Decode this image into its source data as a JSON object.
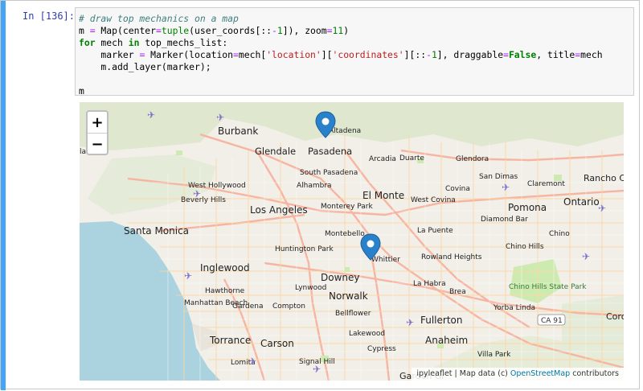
{
  "cell": {
    "prompt": "In [136]:",
    "code": {
      "line1_comment": "# draw top mechanics on a map",
      "line2": [
        "m ",
        "=",
        " Map(center",
        "=",
        "tuple",
        "(user_coords[::",
        "-",
        "1",
        "]), zoom",
        "=",
        "11",
        ")"
      ],
      "line3": [
        "for",
        " mech ",
        "in",
        " top_mechs_list:"
      ],
      "line4": [
        "    marker ",
        "=",
        " Marker(location",
        "=",
        "mech[",
        "'location'",
        "][",
        "'coordinates'",
        "][::",
        "-",
        "1",
        "], draggable",
        "=",
        "False",
        ", title",
        "=",
        "mech"
      ],
      "line5": "    m.add_layer(marker);",
      "line6": "",
      "line7": "m"
    }
  },
  "map": {
    "zoom_in": "+",
    "zoom_out": "−",
    "attribution_prefix": "ipyleaflet | Map data (c) ",
    "attribution_link": "OpenStreetMap",
    "attribution_suffix": " contributors",
    "places": {
      "burbank": "Burbank",
      "glendale": "Glendale",
      "pasadena": "Pasadena",
      "altadena": "Altadena",
      "arcadia": "Arcadia",
      "duarte": "Duarte",
      "glendora": "Glendora",
      "san_dimas": "San Dimas",
      "claremont": "Claremont",
      "rancho": "Rancho Cuc",
      "south_pasadena": "South Pasadena",
      "west_hollywood": "West Hollywood",
      "alhambra": "Alhambra",
      "covina": "Covina",
      "beverly_hills": "Beverly Hills",
      "el_monte": "El Monte",
      "west_covina": "West Covina",
      "pomona": "Pomona",
      "ontario": "Ontario",
      "los_angeles": "Los Angeles",
      "monterey_park": "Monterey Park",
      "diamond_bar": "Diamond Bar",
      "santa_monica": "Santa Monica",
      "montebello": "Montebello",
      "la_puente": "La Puente",
      "chino_hills": "Chino Hills",
      "chino": "Chino",
      "huntington_park": "Huntington Park",
      "whittier": "Whittier",
      "rowland_heights": "Rowland Heights",
      "inglewood": "Inglewood",
      "downey": "Downey",
      "hawthorne": "Hawthorne",
      "lynwood": "Lynwood",
      "la_habra": "La Habra",
      "brea": "Brea",
      "chino_hills_sp": "Chino Hills State Park",
      "manhattan_beach": "Manhattan Beach",
      "gardena": "Gardena",
      "compton": "Compton",
      "norwalk": "Norwalk",
      "yorba_linda": "Yorba Linda",
      "bellflower": "Bellflower",
      "fullerton": "Fullerton",
      "ca91": "CA 91",
      "corona": "Coro",
      "lakewood": "Lakewood",
      "torrance": "Torrance",
      "carson": "Carson",
      "cypress": "Cypress",
      "anaheim": "Anaheim",
      "villa_park": "Villa Park",
      "lomita": "Lomita",
      "signal_hill": "Signal Hill",
      "garden_grove": "Garden Gr",
      "las": "las"
    }
  },
  "colors": {
    "cell_bar": "#42a5f5",
    "marker": "#2a81cb",
    "water": "#aad3df",
    "park": "#cdebb0",
    "urban": "#f2efe9",
    "road_major": "#f6b5a1"
  }
}
